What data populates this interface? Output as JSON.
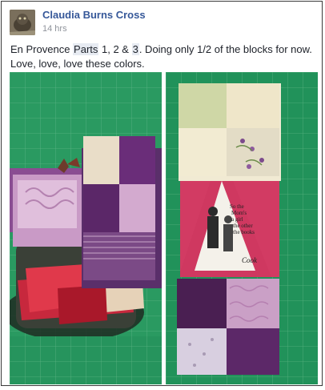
{
  "post": {
    "author": "Claudia Burns Cross",
    "timestamp": "14 hrs",
    "text": {
      "part1": "En Provence ",
      "link_parts": "Parts",
      "part2": " 1, 2 & ",
      "link_3": "3",
      "part3": ". Doing only 1/2 of the blocks for now. Love, love, love these colors."
    },
    "photo_captions": {
      "fabric_line1": "So the",
      "fabric_line2": "Mom's",
      "fabric_line3": "a girl",
      "fabric_line4": "the other",
      "fabric_line5": "the books",
      "fabric_cook": "Cook"
    }
  },
  "colors": {
    "link": "#365899",
    "meta": "#90949c",
    "mat_green": "#1f8f5a"
  }
}
